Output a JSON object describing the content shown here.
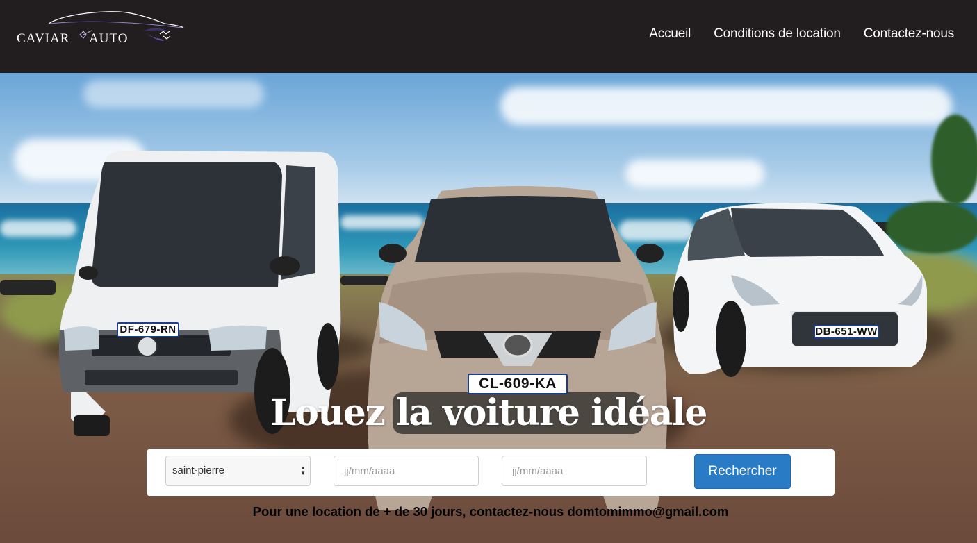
{
  "header": {
    "logo_left": "CAVIAR",
    "logo_right": "AUTO",
    "nav": [
      {
        "label": "Accueil"
      },
      {
        "label": "Conditions de location"
      },
      {
        "label": "Contactez-nous"
      }
    ]
  },
  "hero": {
    "title": "Louez la voiture idéale",
    "plates": {
      "van": "DF-679-RN",
      "suv": "CL-609-KA",
      "hatch": "DB-651-WW"
    },
    "search": {
      "location_value": "saint-pierre",
      "start_placeholder": "jj/mm/aaaa",
      "end_placeholder": "jj/mm/aaaa",
      "button_label": "Rechercher"
    },
    "info_text": "Pour une location de + de 30 jours, contactez-nous domtomimmo@gmail.com"
  },
  "colors": {
    "header_bg": "#221e1f",
    "button_bg": "#2a7bc6"
  }
}
